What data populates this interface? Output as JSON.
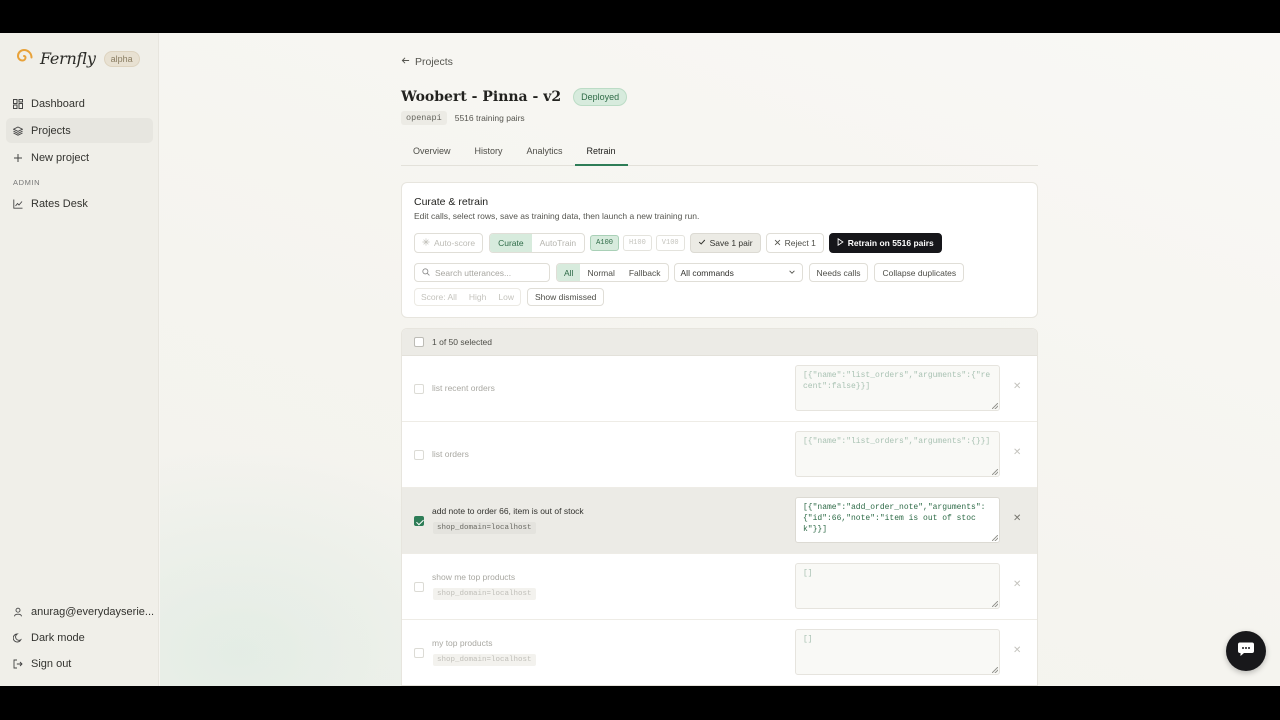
{
  "brand": {
    "name": "Fernfly",
    "badge": "alpha"
  },
  "sidebar": {
    "items": [
      {
        "label": "Dashboard",
        "icon": "dashboard-icon"
      },
      {
        "label": "Projects",
        "icon": "layers-icon"
      },
      {
        "label": "New project",
        "icon": "plus-icon"
      }
    ],
    "admin_label": "ADMIN",
    "admin_items": [
      {
        "label": "Rates Desk",
        "icon": "chart-line-icon"
      }
    ],
    "user": "anurag@everydayserie...",
    "dark_mode": "Dark mode",
    "sign_out": "Sign out"
  },
  "breadcrumb": {
    "label": "Projects"
  },
  "project": {
    "title": "Woobert - Pinna - v2",
    "status": "Deployed",
    "type": "openapi",
    "pairs": "5516 training pairs"
  },
  "tabs": [
    {
      "label": "Overview"
    },
    {
      "label": "History"
    },
    {
      "label": "Analytics"
    },
    {
      "label": "Retrain",
      "active": true
    }
  ],
  "curate": {
    "title": "Curate & retrain",
    "subtitle": "Edit calls, select rows, save as training data, then launch a new training run.",
    "auto_score": "Auto-score",
    "mode_curate": "Curate",
    "mode_autotrain": "AutoTrain",
    "gpus": [
      "A100",
      "H100",
      "V100"
    ],
    "save": "Save 1 pair",
    "reject": "Reject 1",
    "retrain": "Retrain on 5516 pairs",
    "search_placeholder": "Search utterances...",
    "filter_all": "All",
    "filter_normal": "Normal",
    "filter_fallback": "Fallback",
    "commands": "All commands",
    "needs_calls": "Needs calls",
    "collapse": "Collapse duplicates",
    "score_all": "Score: All",
    "score_high": "High",
    "score_low": "Low",
    "show_dismissed": "Show dismissed"
  },
  "list": {
    "selected_text": "1 of 50 selected",
    "rows": [
      {
        "utterance": "list recent orders",
        "context": "",
        "call": "[{\"name\":\"list_orders\",\"arguments\":{\"recent\":false}}]",
        "selected": false
      },
      {
        "utterance": "list orders",
        "context": "",
        "call": "[{\"name\":\"list_orders\",\"arguments\":{}}]",
        "selected": false
      },
      {
        "utterance": "add note to order 66, item is out of stock",
        "context": "shop_domain=localhost",
        "call": "[{\"name\":\"add_order_note\",\"arguments\":{\"id\":66,\"note\":\"item is out of stock\"}}]",
        "selected": true
      },
      {
        "utterance": "show me top products",
        "context": "shop_domain=localhost",
        "call": "[]",
        "selected": false
      },
      {
        "utterance": "my top products",
        "context": "shop_domain=localhost",
        "call": "[]",
        "selected": false
      }
    ]
  },
  "colors": {
    "accent": "#2e7d57",
    "accent_soft": "#d7ebdd",
    "primary_button": "#16161a"
  }
}
